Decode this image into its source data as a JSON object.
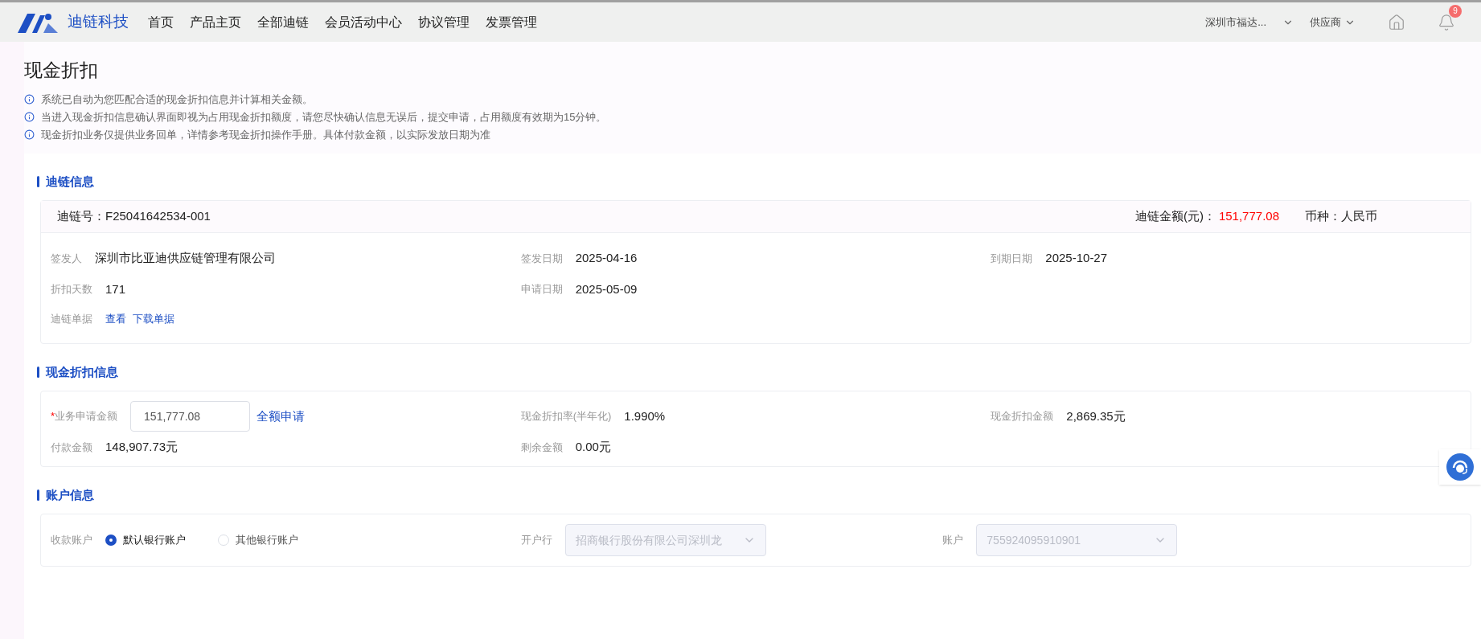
{
  "header": {
    "brand": "迪链科技",
    "nav": [
      "首页",
      "产品主页",
      "全部迪链",
      "会员活动中心",
      "协议管理",
      "发票管理"
    ],
    "company": "深圳市福达...",
    "role": "供应商",
    "notification_count": "9"
  },
  "page": {
    "title": "现金折扣",
    "notices": [
      "系统已自动为您匹配合适的现金折扣信息并计算相关金额。",
      "当进入现金折扣信息确认界面即视为占用现金折扣额度，请您尽快确认信息无误后，提交申请，占用额度有效期为15分钟。",
      "现金折扣业务仅提供业务回单，详情参考现金折扣操作手册。具体付款金额，以实际发放日期为准"
    ]
  },
  "chain_info": {
    "heading": "迪链信息",
    "number_label": "迪链号：",
    "number": "F25041642534-001",
    "amount_label": "迪链金额(元)：",
    "amount": "151,777.08",
    "currency": "币种：人民币",
    "fields": [
      {
        "label": "签发人",
        "value": "深圳市比亚迪供应链管理有限公司"
      },
      {
        "label": "签发日期",
        "value": "2025-04-16"
      },
      {
        "label": "到期日期",
        "value": "2025-10-27"
      },
      {
        "label": "折扣天数",
        "value": "171"
      },
      {
        "label": "申请日期",
        "value": "2025-05-09"
      }
    ],
    "document_label": "迪链单据",
    "links": [
      "查看",
      "下载单据"
    ]
  },
  "discount_info": {
    "heading": "现金折扣信息",
    "apply_label": "业务申请金额",
    "required_mark": "*",
    "apply_amount": "151,777.08",
    "full_amount_link": "全额申请",
    "fields": [
      {
        "label": "现金折扣率(半年化)",
        "value": "1.990%"
      },
      {
        "label": "现金折扣金额",
        "value": "2,869.35元"
      },
      {
        "label": "付款金额",
        "value": "148,907.73元"
      },
      {
        "label": "剩余金额",
        "value": "0.00元"
      }
    ]
  },
  "account_info": {
    "heading": "账户信息",
    "receive_label": "收款账户",
    "options": [
      {
        "label": "默认银行账户",
        "selected": true
      },
      {
        "label": "其他银行账户",
        "selected": false
      }
    ],
    "bank_label": "开户行",
    "bank": {
      "value": "招商银行股份有限公司深圳龙",
      "disabled": true
    },
    "account_label": "账户",
    "account": {
      "value": "755924095910901",
      "disabled": true
    }
  }
}
